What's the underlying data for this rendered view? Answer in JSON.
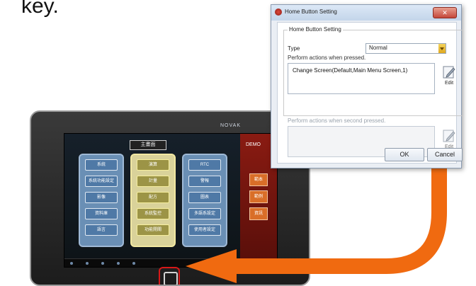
{
  "caption": {
    "text": "key."
  },
  "device": {
    "brand": "NOVAK",
    "screen": {
      "title": "主畫面",
      "side_label": "DEMO",
      "panel_blue1": [
        "系統",
        "系統功能設定",
        "影像",
        "資料庫",
        "語言"
      ],
      "panel_yellow": [
        "演算",
        "計量",
        "配方",
        "系統監控",
        "功能開關"
      ],
      "panel_blue2": [
        "RTC",
        "警報",
        "圖表",
        "多語系設定",
        "使用者設定"
      ],
      "right_buttons": [
        "範本",
        "範例",
        "資訊"
      ]
    }
  },
  "dialog": {
    "title": "Home Button Setting",
    "close_glyph": "✕",
    "group_label": "Home Button Setting",
    "type_label": "Type",
    "type_value": "Normal",
    "pressed_label": "Perform actions when pressed.",
    "pressed_action": "Change Screen(Default,Main Menu Screen,1)",
    "edit_label": "Edit",
    "second_label": "Perform actions when second pressed.",
    "edit2_label": "Edit",
    "ok_label": "OK",
    "cancel_label": "Cancel"
  },
  "colors": {
    "arrow": "#f06a10",
    "highlight": "#d81818",
    "accent_red": "#8a1b12"
  }
}
